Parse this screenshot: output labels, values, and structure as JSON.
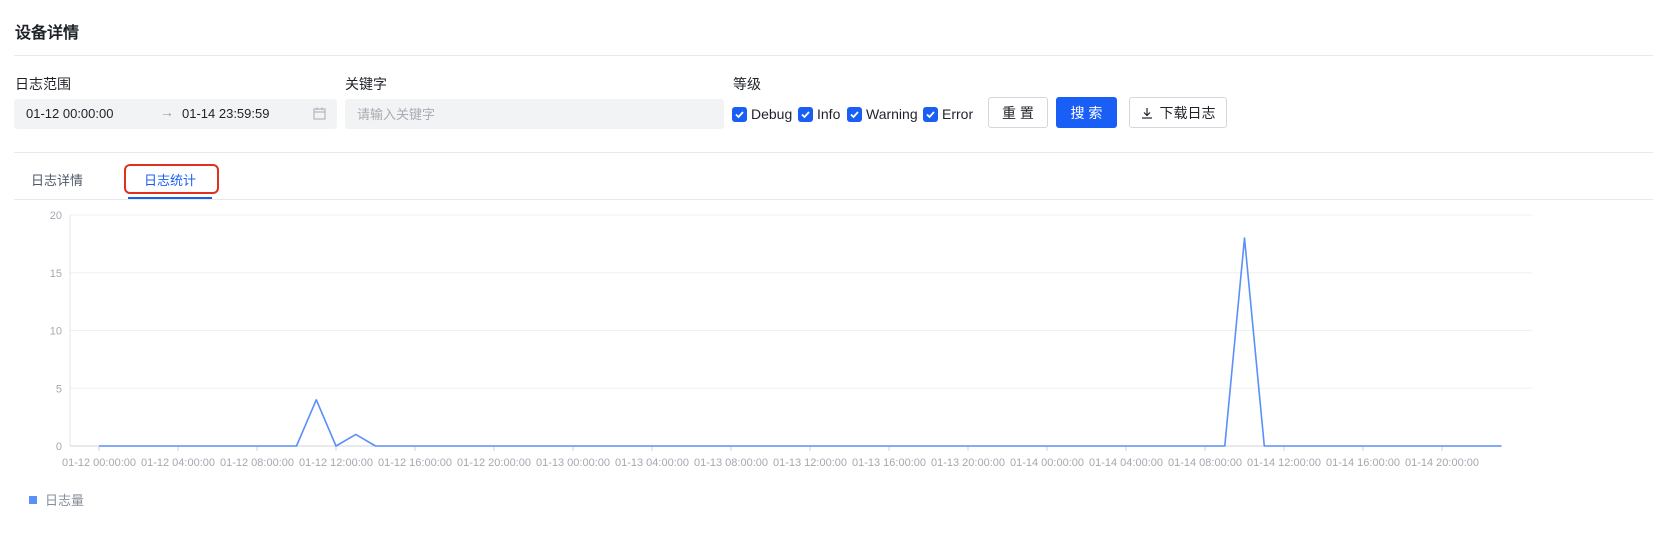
{
  "page": {
    "title": "设备详情"
  },
  "filters": {
    "date_range_label": "日志范围",
    "date_start": "01-12 00:00:00",
    "date_separator": "→",
    "date_end": "01-14 23:59:59",
    "keyword_label": "关键字",
    "keyword_placeholder": "请输入关键字",
    "keyword_value": "",
    "level_label": "等级",
    "levels": [
      {
        "label": "Debug",
        "checked": true
      },
      {
        "label": "Info",
        "checked": true
      },
      {
        "label": "Warning",
        "checked": true
      },
      {
        "label": "Error",
        "checked": true
      }
    ],
    "reset_label": "重 置",
    "search_label": "搜 索",
    "download_label": "下载日志"
  },
  "tabs": [
    {
      "label": "日志详情",
      "active": false
    },
    {
      "label": "日志统计",
      "active": true
    }
  ],
  "colors": {
    "primary": "#1a5ff5",
    "series": "#5b8ff9",
    "annotation": "#e0311c"
  },
  "chart_data": {
    "type": "line",
    "title": "",
    "xlabel": "",
    "ylabel": "",
    "ylim": [
      0,
      20
    ],
    "yticks": [
      "0",
      "5",
      "10",
      "15",
      "20"
    ],
    "xtick_labels": [
      "01-12 00:00:00",
      "01-12 04:00:00",
      "01-12 08:00:00",
      "01-12 12:00:00",
      "01-12 16:00:00",
      "01-12 20:00:00",
      "01-13 00:00:00",
      "01-13 04:00:00",
      "01-13 08:00:00",
      "01-13 12:00:00",
      "01-13 16:00:00",
      "01-13 20:00:00",
      "01-14 00:00:00",
      "01-14 04:00:00",
      "01-14 08:00:00",
      "01-14 12:00:00",
      "01-14 16:00:00",
      "01-14 20:00:00"
    ],
    "grid": true,
    "legend_position": "bottom-left",
    "series": [
      {
        "name": "日志量",
        "values": [
          0,
          0,
          0,
          0,
          0,
          0,
          0,
          0,
          0,
          0,
          0,
          4,
          0,
          1,
          0,
          0,
          0,
          0,
          0,
          0,
          0,
          0,
          0,
          0,
          0,
          0,
          0,
          0,
          0,
          0,
          0,
          0,
          0,
          0,
          0,
          0,
          0,
          0,
          0,
          0,
          0,
          0,
          0,
          0,
          0,
          0,
          0,
          0,
          0,
          0,
          0,
          0,
          0,
          0,
          0,
          0,
          0,
          0,
          18,
          0,
          0,
          0,
          0,
          0,
          0,
          0,
          0,
          0,
          0,
          0,
          0,
          0
        ]
      }
    ]
  }
}
